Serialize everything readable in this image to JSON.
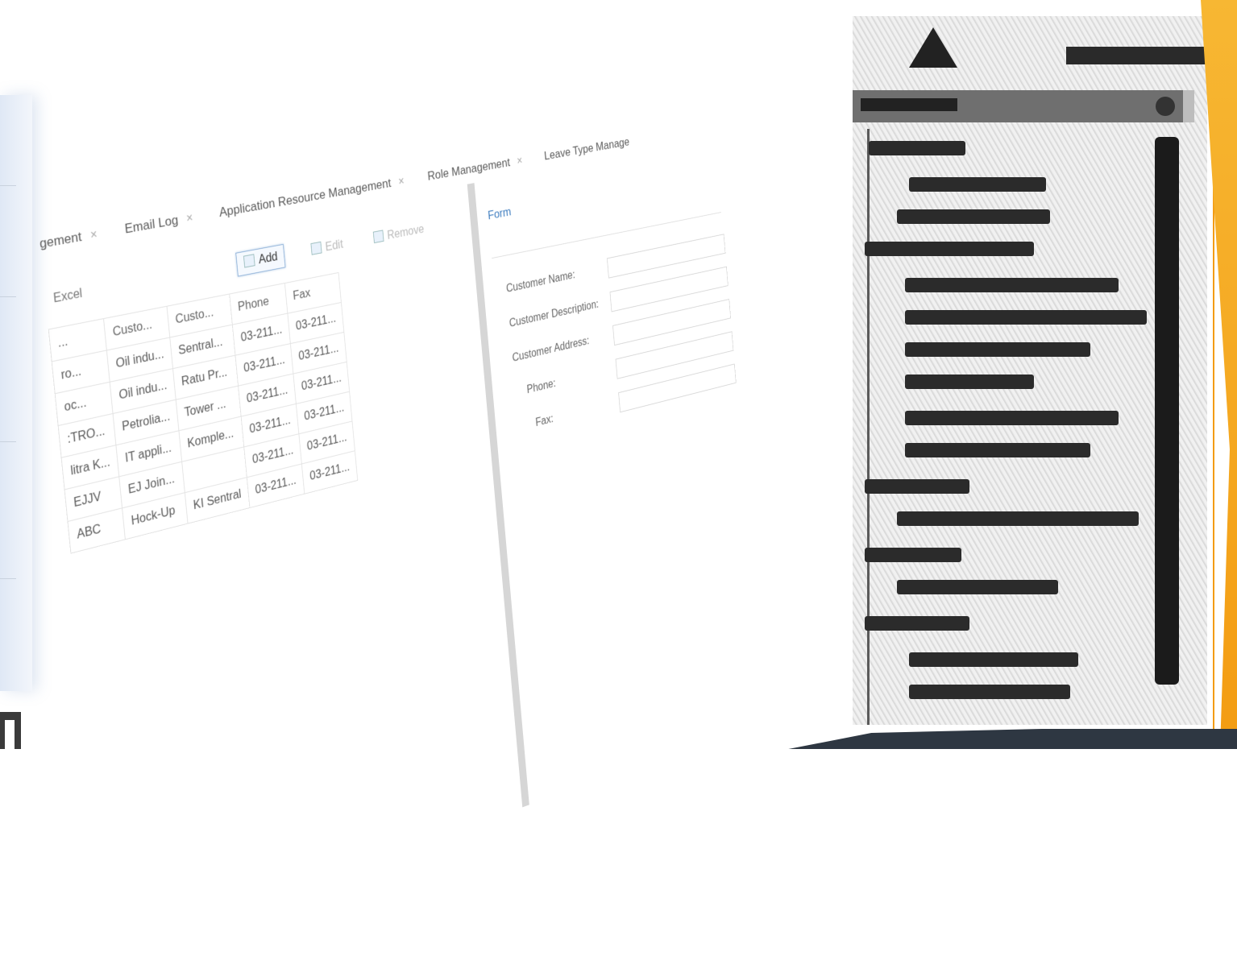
{
  "tabs": [
    {
      "label": "gement",
      "close": "×"
    },
    {
      "label": "Email Log",
      "close": "×"
    },
    {
      "label": "Application Resource Management",
      "close": "×"
    },
    {
      "label": "Role Management",
      "close": "×"
    },
    {
      "label": "Leave Type Manage",
      "close": ""
    }
  ],
  "toolbar": {
    "excel_label": "Excel",
    "add_label": "Add",
    "edit_label": "Edit",
    "remove_label": "Remove"
  },
  "grid": {
    "columns": [
      "...",
      "Custo...",
      "Custo...",
      "Phone",
      "Fax"
    ],
    "rows": [
      [
        "ro...",
        "Oil indu...",
        "Sentral...",
        "03-211...",
        "03-211..."
      ],
      [
        "oc...",
        "Oil indu...",
        "Ratu Pr...",
        "03-211...",
        "03-211..."
      ],
      [
        ":TRO...",
        "Petrolia...",
        "Tower ...",
        "03-211...",
        "03-211..."
      ],
      [
        "litra K...",
        "IT appli...",
        "Komple...",
        "03-211...",
        "03-211..."
      ],
      [
        "EJJV",
        "EJ Join...",
        "",
        "03-211...",
        "03-211..."
      ],
      [
        "ABC",
        "Hock-Up",
        "KI Sentral",
        "03-211...",
        "03-211..."
      ]
    ]
  },
  "form": {
    "title": "Form",
    "fields": [
      {
        "label": "Customer Name:"
      },
      {
        "label": "Customer Description:"
      },
      {
        "label": "Customer Address:"
      },
      {
        "label": "Phone:"
      },
      {
        "label": "Fax:"
      }
    ]
  },
  "colors": {
    "accent": "#3b7bbf",
    "stripe": "#f39c12",
    "band": "#2e3742"
  },
  "icons": [
    "add-icon",
    "edit-icon",
    "remove-icon",
    "close-icon",
    "settings-icon"
  ]
}
